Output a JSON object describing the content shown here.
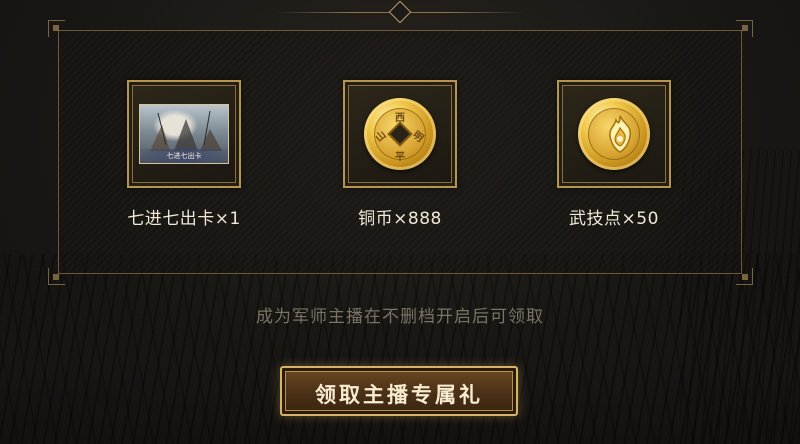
{
  "rewards": [
    {
      "label": "七进七出卡×1",
      "icon": "card-icon",
      "card_caption": "七进七出卡"
    },
    {
      "label": "铜币×888",
      "icon": "copper-coin-icon",
      "coin_glyphs": [
        "西",
        "明",
        "平",
        "山"
      ]
    },
    {
      "label": "武技点×50",
      "icon": "martial-points-coin-icon"
    }
  ],
  "notice": "成为军师主播在不删档开启后可领取",
  "claim_button": {
    "label": "领取主播专属礼"
  },
  "colors": {
    "gold": "#b8954d",
    "button_text": "#f7ecd2",
    "label_text": "#f1e8d6",
    "notice_text": "#7a7366"
  }
}
